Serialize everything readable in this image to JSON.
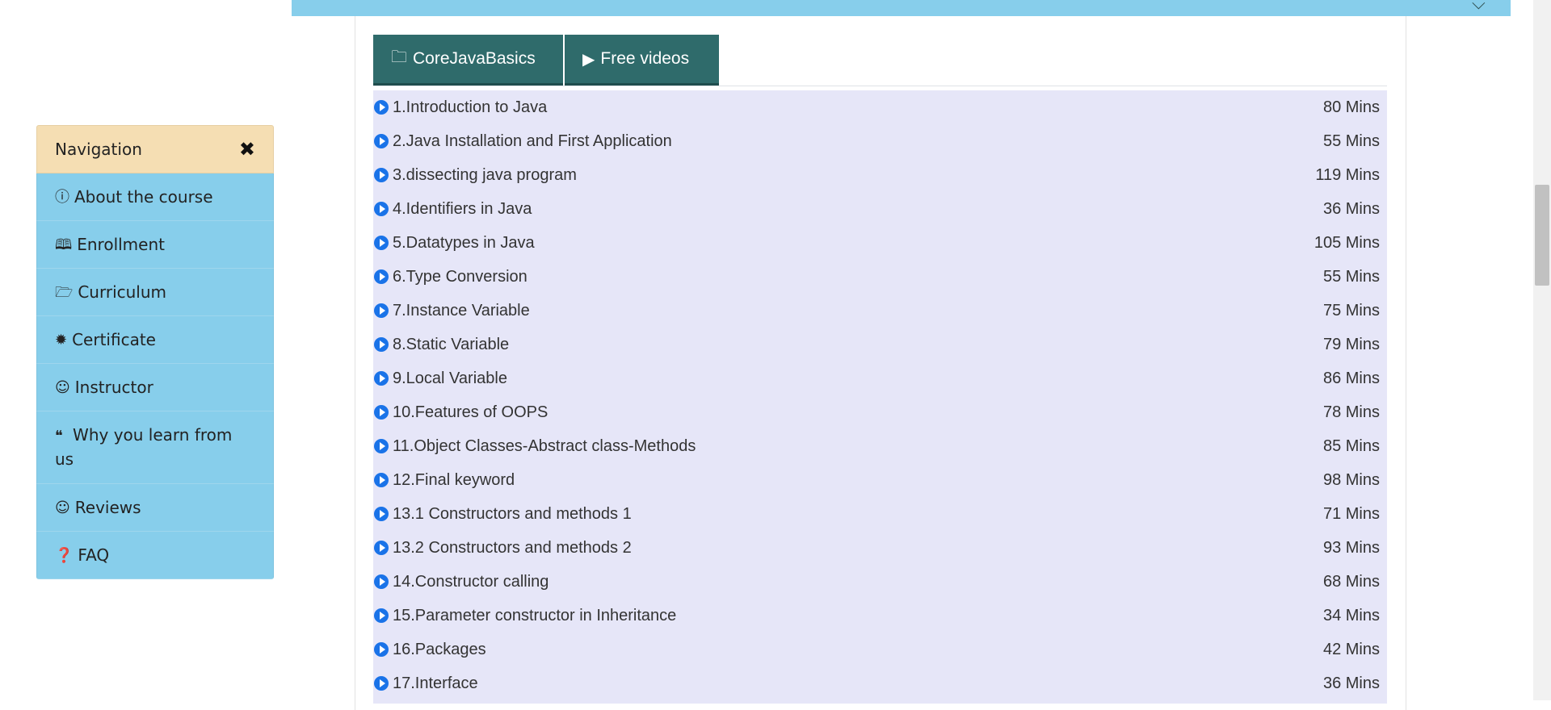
{
  "tabs": [
    {
      "label": "CoreJavaBasics",
      "icon": "folder-icon"
    },
    {
      "label": "Free videos",
      "icon": "play-circle-icon"
    }
  ],
  "lessons": [
    {
      "title": "1.Introduction to Java",
      "duration": "80 Mins"
    },
    {
      "title": "2.Java Installation and First Application",
      "duration": "55 Mins"
    },
    {
      "title": "3.dissecting java program",
      "duration": "119 Mins"
    },
    {
      "title": "4.Identifiers in Java",
      "duration": "36 Mins"
    },
    {
      "title": "5.Datatypes in Java",
      "duration": "105 Mins"
    },
    {
      "title": "6.Type Conversion",
      "duration": "55 Mins"
    },
    {
      "title": "7.Instance Variable",
      "duration": "75 Mins"
    },
    {
      "title": "8.Static Variable",
      "duration": "79 Mins"
    },
    {
      "title": "9.Local Variable",
      "duration": "86 Mins"
    },
    {
      "title": "10.Features of OOPS",
      "duration": "78 Mins"
    },
    {
      "title": "11.Object Classes-Abstract class-Methods",
      "duration": "85 Mins"
    },
    {
      "title": "12.Final keyword",
      "duration": "98 Mins"
    },
    {
      "title": "13.1 Constructors and methods 1",
      "duration": "71 Mins"
    },
    {
      "title": "13.2 Constructors and methods 2",
      "duration": "93 Mins"
    },
    {
      "title": "14.Constructor calling",
      "duration": "68 Mins"
    },
    {
      "title": "15.Parameter constructor in Inheritance",
      "duration": "34 Mins"
    },
    {
      "title": "16.Packages",
      "duration": "42 Mins"
    },
    {
      "title": "17.Interface",
      "duration": "36 Mins"
    }
  ],
  "navigation": {
    "title": "Navigation",
    "close_icon": "close-icon",
    "items": [
      {
        "label": "About the course",
        "icon": "info-circle-icon"
      },
      {
        "label": "Enrollment",
        "icon": "open-book-icon"
      },
      {
        "label": "Curriculum",
        "icon": "folder-open-icon"
      },
      {
        "label": "Certificate",
        "icon": "certificate-icon"
      },
      {
        "label": "Instructor",
        "icon": "user-circle-icon"
      },
      {
        "label": "Why you learn from us",
        "icon": "quote-icon"
      },
      {
        "label": "Reviews",
        "icon": "smile-icon"
      },
      {
        "label": "FAQ",
        "icon": "question-circle-icon"
      }
    ]
  },
  "colors": {
    "banner": "#87ceeb",
    "tab_bg": "#2f6b6b",
    "lesson_bg": "#e6e6f8",
    "nav_header": "#f5deb3",
    "nav_item": "#87ceeb",
    "play_icon": "#1a73e8"
  }
}
